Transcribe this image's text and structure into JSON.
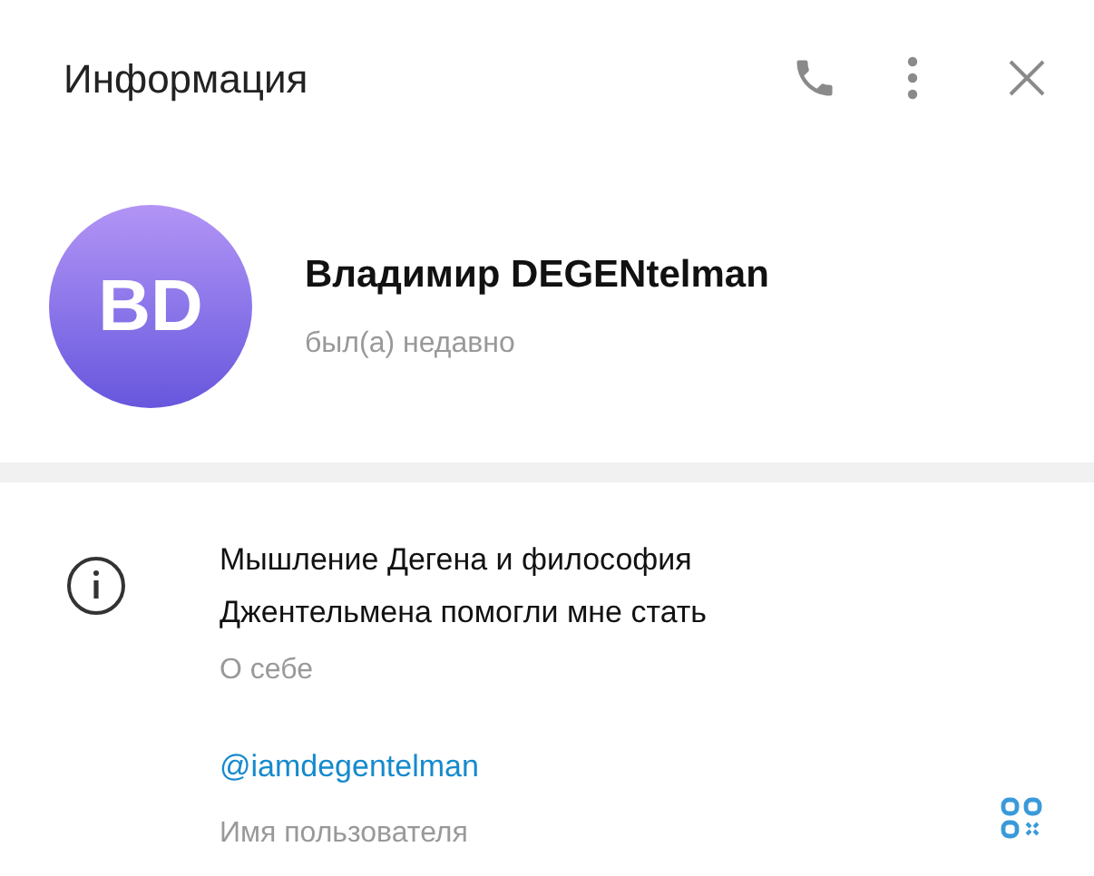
{
  "header": {
    "title": "Информация"
  },
  "profile": {
    "initials": "BD",
    "name": "Владимир DEGENtelman",
    "status": "был(а) недавно"
  },
  "info": {
    "bio": "Мышление Дегена и философия Джентельмена помогли мне стать",
    "bio_label": "О себе",
    "username": "@iamdegentelman",
    "username_label": "Имя пользователя"
  }
}
